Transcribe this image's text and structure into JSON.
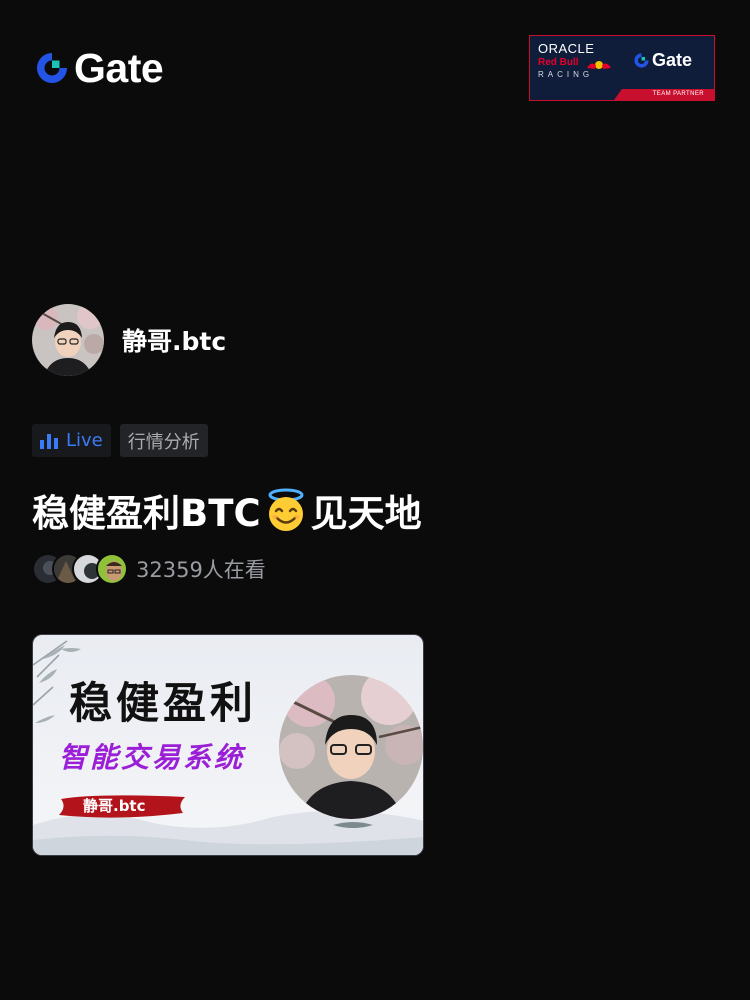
{
  "brand": {
    "logo_text": "Gate",
    "primary_color": "#2354e6",
    "accent_color": "#19c3b6"
  },
  "partner_banner": {
    "oracle": "ORACLE",
    "redbull": "Red Bull",
    "racing": "RACING",
    "gate": "Gate",
    "badge": "TEAM PARTNER",
    "border_color": "#c8102e"
  },
  "stream": {
    "host_name": "静哥.btc",
    "live_label": "Live",
    "category": "行情分析",
    "title_before": "稳健盈利BTC",
    "title_emoji": "smiling-face-with-halo",
    "title_after": "见天地",
    "viewer_count": "32359人在看"
  },
  "cover": {
    "headline": "稳健盈利",
    "subtitle": "智能交易系统",
    "name_tag": "静哥.btc"
  }
}
